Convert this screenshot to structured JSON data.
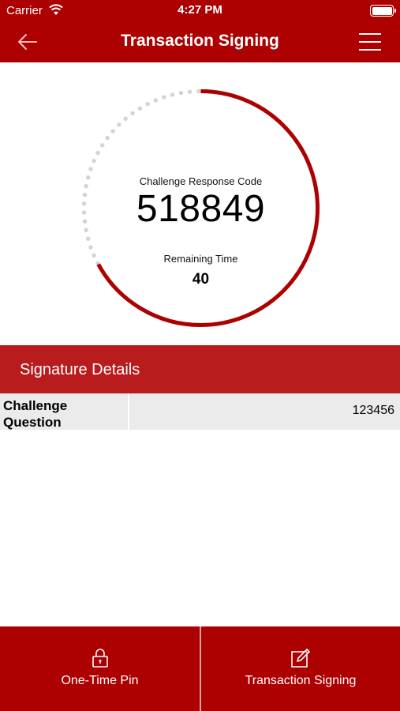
{
  "status_bar": {
    "carrier": "Carrier",
    "time": "4:27 PM"
  },
  "nav": {
    "title": "Transaction Signing",
    "back_icon": "arrow-left-icon",
    "menu_icon": "hamburger-menu-icon"
  },
  "timer": {
    "code_label": "Challenge Response Code",
    "code": "518849",
    "time_label": "Remaining Time",
    "remaining": "40",
    "progress_fraction": 0.67,
    "active_color": "#ad0000",
    "inactive_color": "#d4d4d4"
  },
  "signature": {
    "title": "Signature Details",
    "rows": [
      {
        "label": "Challenge Question",
        "value": "123456"
      }
    ]
  },
  "tabs": [
    {
      "label": "One-Time Pin",
      "icon": "lock-icon"
    },
    {
      "label": "Transaction Signing",
      "icon": "edit-pencil-icon"
    }
  ],
  "colors": {
    "brand": "#ad0000",
    "section_header": "#b81c1c",
    "row_bg": "#ebebeb"
  }
}
